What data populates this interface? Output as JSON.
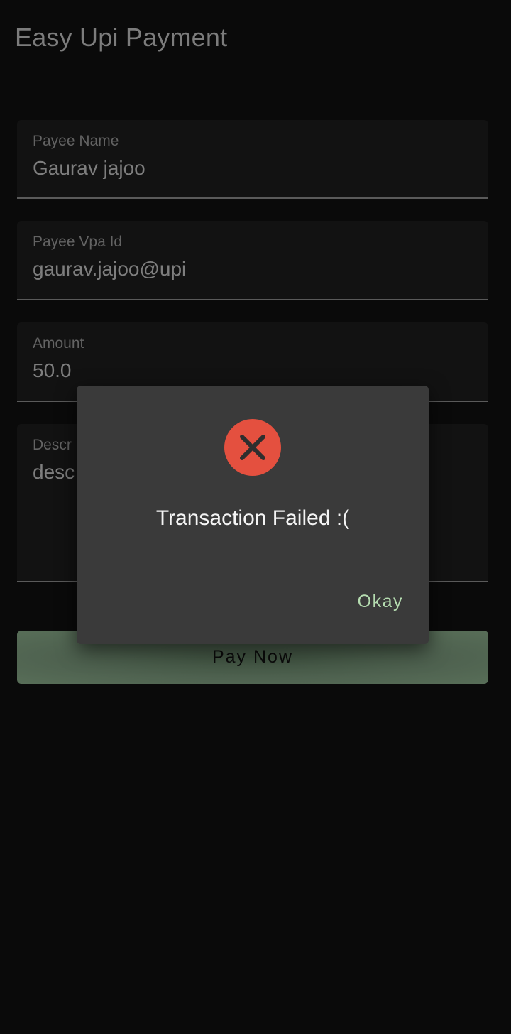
{
  "app": {
    "title": "Easy Upi Payment"
  },
  "form": {
    "payee_name": {
      "label": "Payee Name",
      "value": "Gaurav jajoo"
    },
    "payee_vpa": {
      "label": "Payee Vpa Id",
      "value": "gaurav.jajoo@upi"
    },
    "amount": {
      "label": "Amount",
      "value": "50.0"
    },
    "description": {
      "label": "Descr",
      "value": "desc"
    }
  },
  "pay_button": {
    "label": "Pay Now"
  },
  "dialog": {
    "icon": "error-icon",
    "message": "Transaction Failed :(",
    "okay_label": "Okay"
  },
  "colors": {
    "background": "#0a0a0a",
    "dialog_background": "#3a3a3a",
    "error_red": "#e4503f",
    "okay_accent": "#b5dcb0",
    "pay_button": "#4e614f"
  }
}
